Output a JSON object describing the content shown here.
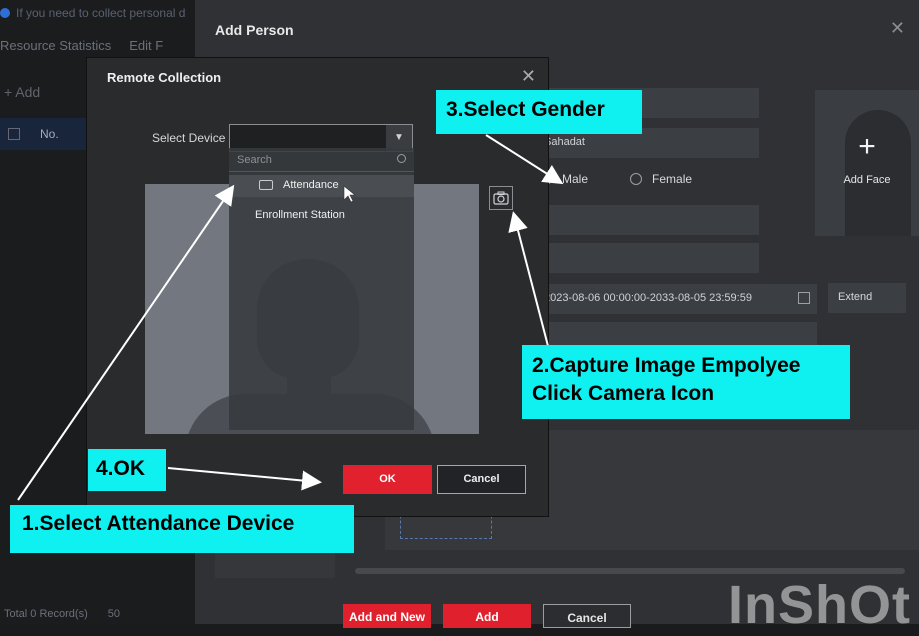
{
  "background": {
    "notice": "If you need to collect personal d",
    "tabs": [
      "Resource Statistics",
      "Edit F"
    ],
    "add_label": "Add",
    "table_col": "No.",
    "footer_records": "Total 0 Record(s)",
    "footer_page_size": "50"
  },
  "add_person": {
    "title": "Add Person",
    "name_value": "Sahadat",
    "gender_options": [
      "Male",
      "Female"
    ],
    "validity": "2023-08-06 00:00:00-2033-08-05 23:59:59",
    "extend_label": "Extend",
    "add_face_label": "Add Face",
    "buttons": {
      "add_and_new": "Add and New",
      "add": "Add",
      "cancel": "Cancel"
    }
  },
  "remote_collection": {
    "title": "Remote Collection",
    "select_device_label": "Select Device",
    "search_placeholder": "Search",
    "devices": [
      "Attendance",
      "Enrollment Station"
    ],
    "ok": "OK",
    "cancel": "Cancel"
  },
  "annotations": {
    "step1": "1.Select Attendance Device",
    "step2_line1": "2.Capture Image Empolyee",
    "step2_line2": "Click Camera Icon",
    "step3": "3.Select Gender",
    "step4": "4.OK"
  },
  "watermark": "InShOt",
  "colors": {
    "accent_red": "#e0202c",
    "callout": "#0ff0f0",
    "dialog_bg": "#2a2b2d"
  }
}
